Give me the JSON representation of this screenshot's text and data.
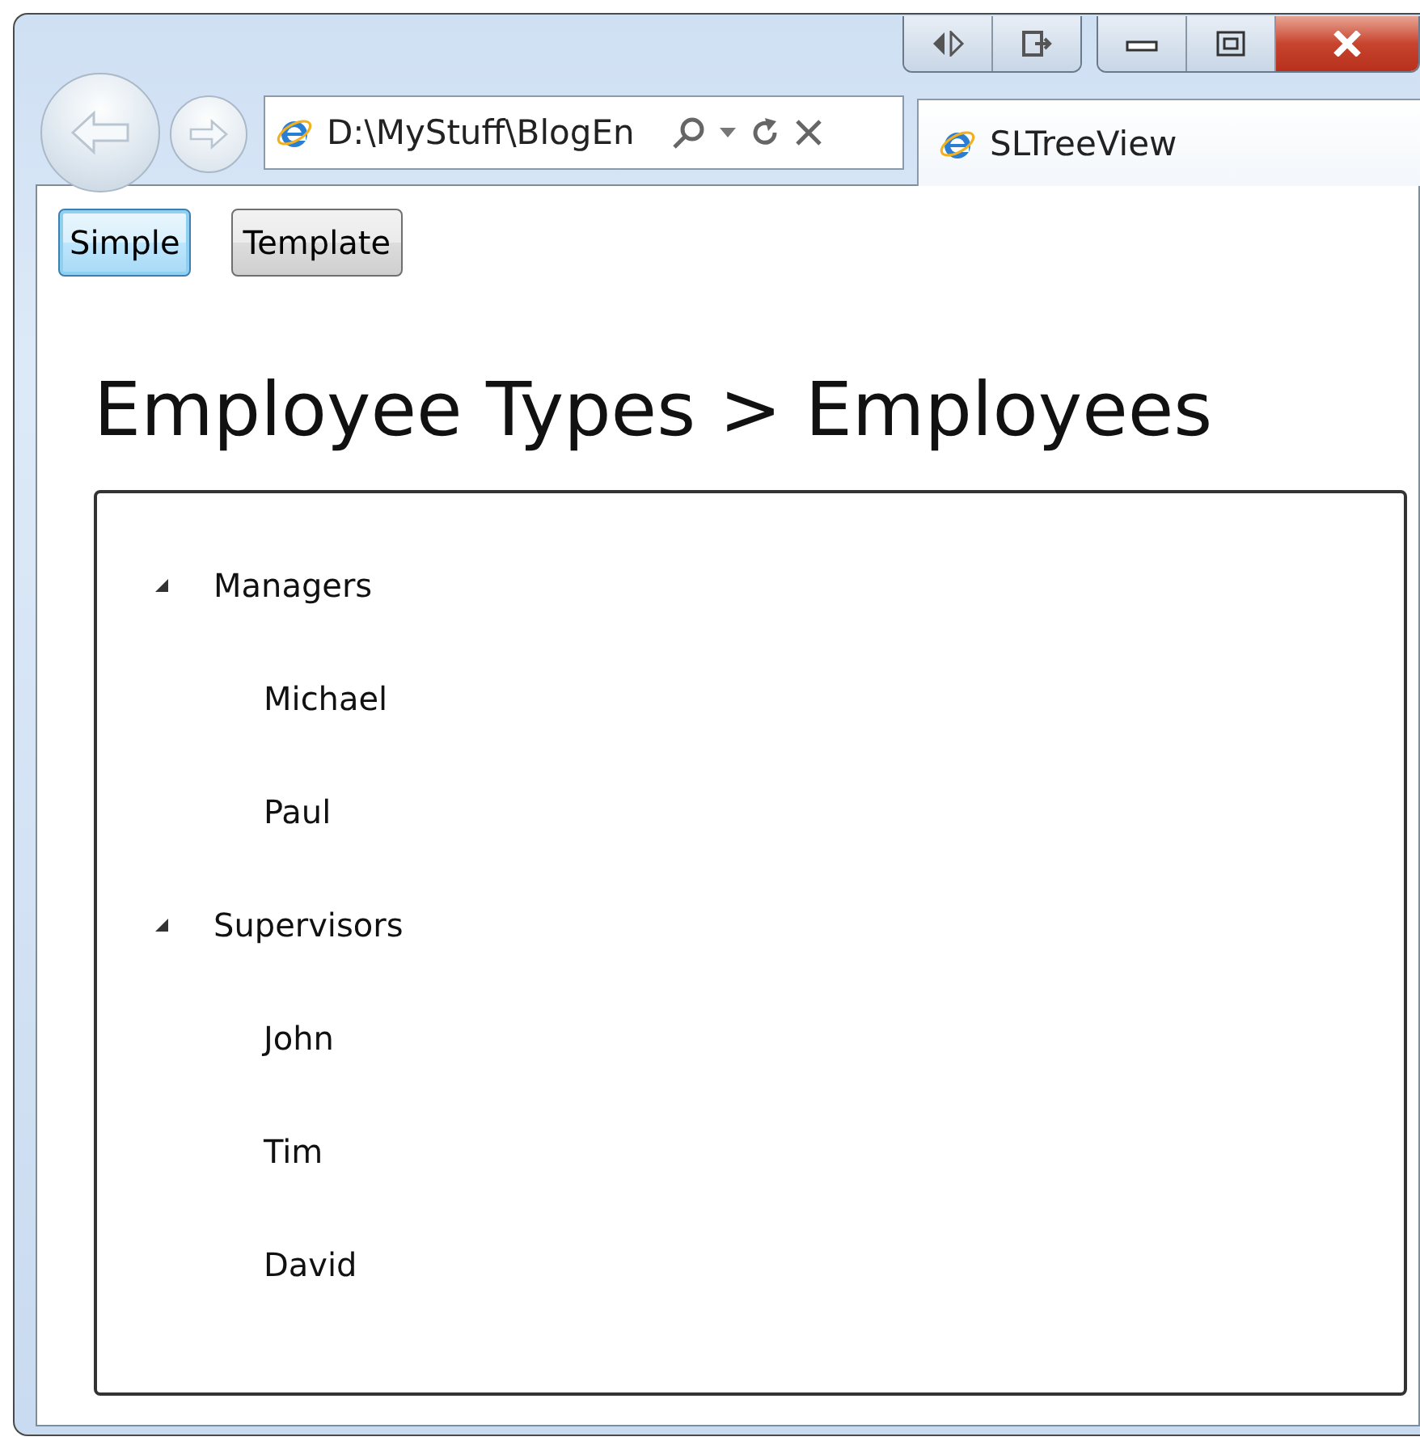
{
  "browser": {
    "address": "D:\\MyStuff\\BlogEn",
    "tab_title": "SLTreeView"
  },
  "toolbar": {
    "buttons": [
      {
        "label": "Simple",
        "focused": true
      },
      {
        "label": "Template",
        "focused": false
      }
    ]
  },
  "heading": "Employee Types > Employees",
  "tree": {
    "items": [
      {
        "label": "Managers",
        "expanded": true,
        "children": [
          {
            "label": "Michael"
          },
          {
            "label": "Paul"
          }
        ]
      },
      {
        "label": "Supervisors",
        "expanded": true,
        "children": [
          {
            "label": "John"
          },
          {
            "label": "Tim"
          },
          {
            "label": "David"
          }
        ]
      }
    ]
  }
}
